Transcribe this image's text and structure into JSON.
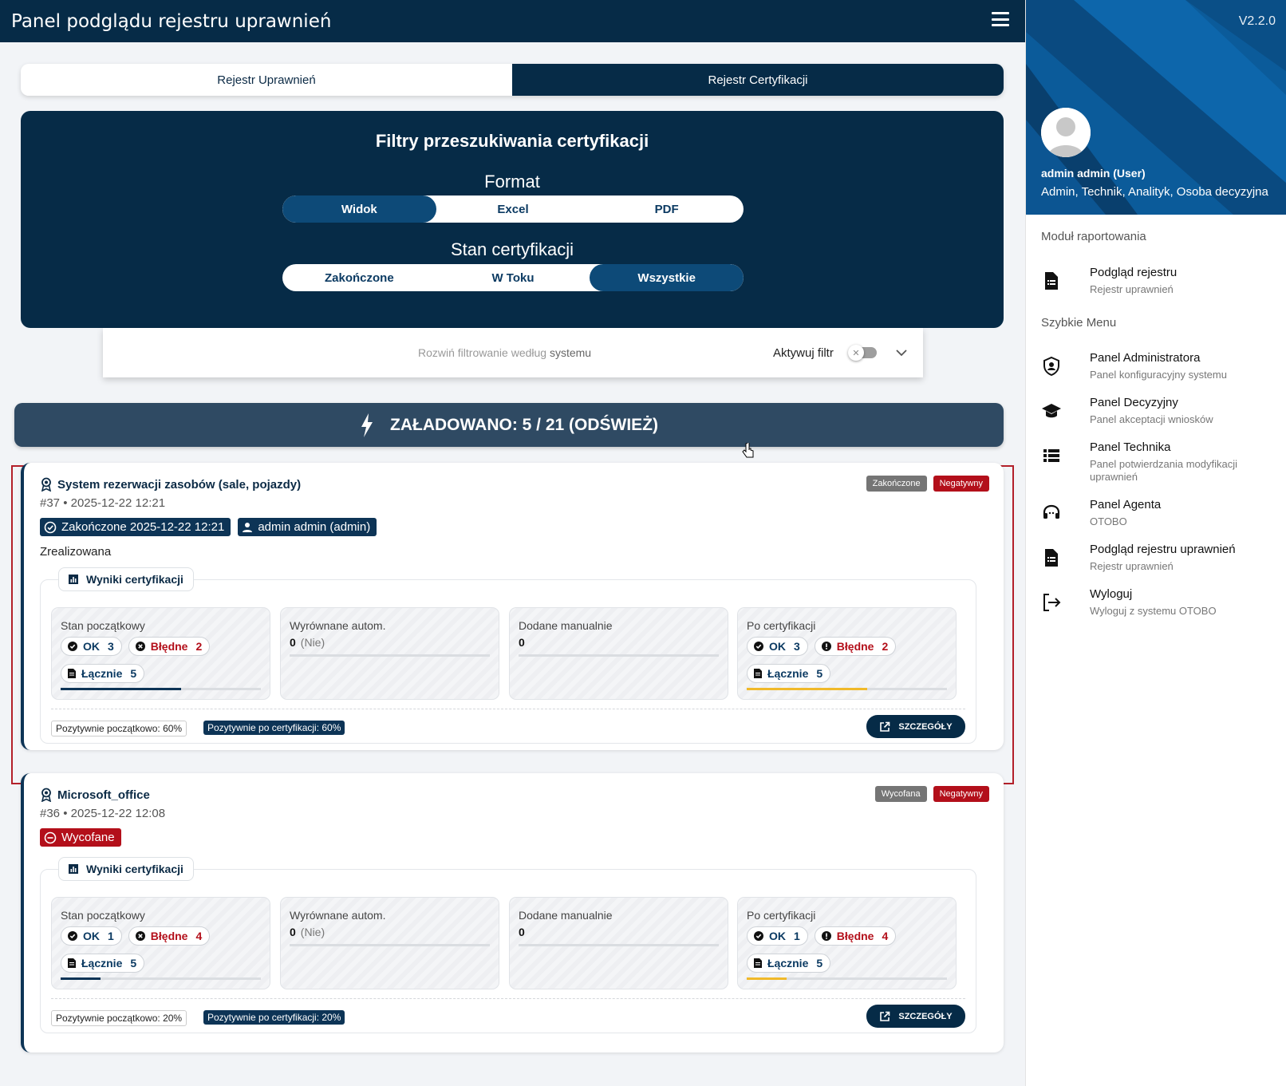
{
  "app": {
    "title": "Panel podglądu rejestru uprawnień",
    "menu_icon": "hamburger-menu-icon"
  },
  "tabs": [
    {
      "label": "Rejestr Uprawnień",
      "active": false
    },
    {
      "label": "Rejestr Certyfikacji",
      "active": true
    }
  ],
  "filters": {
    "title": "Filtry przeszukiwania certyfikacji",
    "format_label": "Format",
    "format_options": [
      "Widok",
      "Excel",
      "PDF"
    ],
    "format_selected": "Widok",
    "state_label": "Stan certyfikacji",
    "state_options": [
      "Zakończone",
      "W Toku",
      "Wszystkie"
    ],
    "state_selected": "Wszystkie",
    "system_filter_text": "Rozwiń filtrowanie według",
    "system_filter_emph": "systemu",
    "activate_label": "Aktywuj filtr",
    "activate_on": false
  },
  "loaded": {
    "text": "ZAŁADOWANO: 5 / 21 (ODŚWIEŻ)"
  },
  "cards": [
    {
      "title": "System rezerwacji zasobów (sale, pojazdy)",
      "meta": "#37 • 2025-12-22 12:21",
      "status_tag": "Zakończone",
      "result_tag": "Negatywny",
      "status_chip": "Zakończone 2025-12-22 12:21",
      "user_chip": "admin admin (admin)",
      "outcome": "Zrealizowana",
      "results_title": "Wyniki certyfikacji",
      "initial": {
        "label": "Stan początkowy",
        "ok_label": "OK",
        "ok": "3",
        "err_label": "Błędne",
        "err": "2",
        "total_label": "Łącznie",
        "total": "5",
        "progress": 0.6
      },
      "auto": {
        "label": "Wyrównane autom.",
        "value": "0",
        "note": "(Nie)"
      },
      "manual": {
        "label": "Dodane manualnie",
        "value": "0"
      },
      "after": {
        "label": "Po certyfikacji",
        "ok_label": "OK",
        "ok": "3",
        "err_label": "Błędne",
        "err": "2",
        "total_label": "Łącznie",
        "total": "5",
        "progress": 0.6
      },
      "pct_initial": "Pozytywnie początkowo: 60%",
      "pct_after": "Pozytywnie po certyfikacji: 60%",
      "details_label": "SZCZEGÓŁY"
    },
    {
      "title": "Microsoft_office",
      "meta": "#36 • 2025-12-22 12:08",
      "status_tag": "Wycofana",
      "result_tag": "Negatywny",
      "status_chip": "Wycofane",
      "results_title": "Wyniki certyfikacji",
      "initial": {
        "label": "Stan początkowy",
        "ok_label": "OK",
        "ok": "1",
        "err_label": "Błędne",
        "err": "4",
        "total_label": "Łącznie",
        "total": "5",
        "progress": 0.2
      },
      "auto": {
        "label": "Wyrównane autom.",
        "value": "0",
        "note": "(Nie)"
      },
      "manual": {
        "label": "Dodane manualnie",
        "value": "0"
      },
      "after": {
        "label": "Po certyfikacji",
        "ok_label": "OK",
        "ok": "1",
        "err_label": "Błędne",
        "err": "4",
        "total_label": "Łącznie",
        "total": "5",
        "progress": 0.2
      },
      "pct_initial": "Pozytywnie początkowo: 20%",
      "pct_after": "Pozytywnie po certyfikacji: 20%",
      "details_label": "SZCZEGÓŁY"
    }
  ],
  "sidebar": {
    "version": "V2.2.0",
    "user_name": "admin admin (User)",
    "user_roles": "Admin, Technik, Analityk, Osoba decyzyjna",
    "section_reporting": "Moduł raportowania",
    "section_quick": "Szybkie Menu",
    "items": [
      {
        "title": "Podgląd rejestru",
        "subtitle": "Rejestr uprawnień",
        "icon": "document-icon"
      },
      {
        "title": "Panel Administratora",
        "subtitle": "Panel konfiguracyjny systemu",
        "icon": "shield-user-icon"
      },
      {
        "title": "Panel Decyzyjny",
        "subtitle": "Panel akceptacji wniosków",
        "icon": "graduation-cap-icon"
      },
      {
        "title": "Panel Technika",
        "subtitle": "Panel potwierdzania modyfikacji uprawnień",
        "icon": "list-icon"
      },
      {
        "title": "Panel Agenta",
        "subtitle": "OTOBO",
        "icon": "headset-icon"
      },
      {
        "title": "Podgląd rejestru uprawnień",
        "subtitle": "Rejestr uprawnień",
        "icon": "document-icon"
      },
      {
        "title": "Wyloguj",
        "subtitle": "Wyloguj z systemu OTOBO",
        "icon": "logout-icon"
      }
    ]
  },
  "colors": {
    "primary": "#062b47",
    "accent_blue": "#0d4a78",
    "danger": "#b30f1a",
    "progress_after": "#f0b92a",
    "progress_initial": "#0d3456"
  }
}
